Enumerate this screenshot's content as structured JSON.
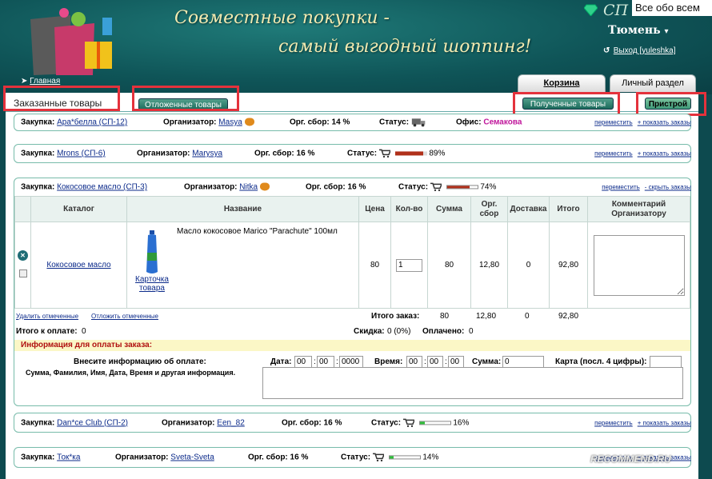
{
  "header": {
    "slogan_line1": "Совместные покупки -",
    "slogan_line2": "самый выгодный шоппинг!",
    "brand": "СП Кл",
    "corner_overlay": "Все обо всем",
    "city": "Тюмень",
    "logout_label": "Выход [yuleshka]",
    "home_label": "Главная"
  },
  "tabs": {
    "cart": "Корзина",
    "personal": "Личный раздел"
  },
  "subtabs": {
    "ordered": "Заказанные товары",
    "deferred": "Отложенные товары",
    "received": "Полученные товары",
    "pristroi": "Пристрой"
  },
  "purchases": [
    {
      "purchase_label": "Закупка:",
      "purchase_name": "Ара*белла (СП-12)",
      "org_label": "Организатор:",
      "organizer": "Masya",
      "fee_label": "Орг. сбор: 14 %",
      "status_label": "Статус:",
      "office_label": "Офис:",
      "office": "Семакова",
      "move_link": "переместить",
      "toggle_link": "+ показать заказы"
    },
    {
      "purchase_label": "Закупка:",
      "purchase_name": "Mrons (СП-6)",
      "org_label": "Организатор:",
      "organizer": "Marysya",
      "fee_label": "Орг. сбор: 16 %",
      "status_label": "Статус:",
      "progress_text": "89%",
      "progress": 0.89,
      "move_link": "переместить",
      "toggle_link": "+ показать заказы"
    },
    {
      "purchase_label": "Закупка:",
      "purchase_name": "Кокосовое масло (СП-3)",
      "org_label": "Организатор:",
      "organizer": "Nitka",
      "fee_label": "Орг. сбор: 16 %",
      "status_label": "Статус:",
      "progress_text": "74%",
      "progress": 0.74,
      "move_link": "переместить",
      "toggle_link": "- скрыть заказы"
    },
    {
      "purchase_label": "Закупка:",
      "purchase_name": "Dan*ce Club (СП-2)",
      "org_label": "Организатор:",
      "organizer": "Een_82",
      "fee_label": "Орг. сбор: 16 %",
      "status_label": "Статус:",
      "progress_text": "16%",
      "progress": 0.16,
      "move_link": "переместить",
      "toggle_link": "+ показать заказы"
    },
    {
      "purchase_label": "Закупка:",
      "purchase_name": "Ток*ка",
      "org_label": "Организатор:",
      "organizer": "Sveta-Sveta",
      "fee_label": "Орг. сбор: 16 %",
      "status_label": "Статус:",
      "progress_text": "14%",
      "progress": 0.14,
      "move_link": "переместить",
      "toggle_link": "+ показать заказы"
    }
  ],
  "order_table": {
    "headers": [
      "Каталог",
      "Название",
      "Цена",
      "Кол-во",
      "Сумма",
      "Орг. сбор",
      "Доставка",
      "Итого",
      "Комментарий Организатору"
    ],
    "row": {
      "catalog": "Кокосовое масло",
      "product_name": "Масло кокосовое Marico \"Parachute\" 100мл",
      "product_card": "Карточка товара",
      "price": "80",
      "qty": "1",
      "sum": "80",
      "fee": "12,80",
      "delivery": "0",
      "total": "92,80"
    },
    "delete_link": "Удалить отмеченные",
    "defer_link": "Отложить отмеченные",
    "order_total_label": "Итого заказ:",
    "totals": {
      "sum": "80",
      "fee": "12,80",
      "delivery": "0",
      "total": "92,80"
    },
    "to_pay_label": "Итого к оплате:",
    "to_pay": "0",
    "discount_label": "Скидка:",
    "discount": "0 (0%)",
    "paid_label": "Оплачено:",
    "paid": "0"
  },
  "payment": {
    "title": "Информация для оплаты заказа:",
    "instr1": "Внесите информацию об оплате:",
    "instr2": "Сумма, Фамилия, Имя, Дата, Время и другая информация.",
    "date_label": "Дата:",
    "date_dd": "00",
    "date_mm": "00",
    "date_yyyy": "0000",
    "time_label": "Время:",
    "time_hh": "00",
    "time_mm": "00",
    "time_ss": "00",
    "sum_label": "Сумма:",
    "sum_value": "0",
    "card_label": "Карта (посл. 4 цифры):"
  },
  "watermark": "RECOMMEND.RU",
  "colors": {
    "header_bg": "#0f5558",
    "accent_green": "#1c6b5c",
    "highlight_red": "#e4323c",
    "progress_red": "#b0301a",
    "progress_green": "#2fbf3a"
  }
}
